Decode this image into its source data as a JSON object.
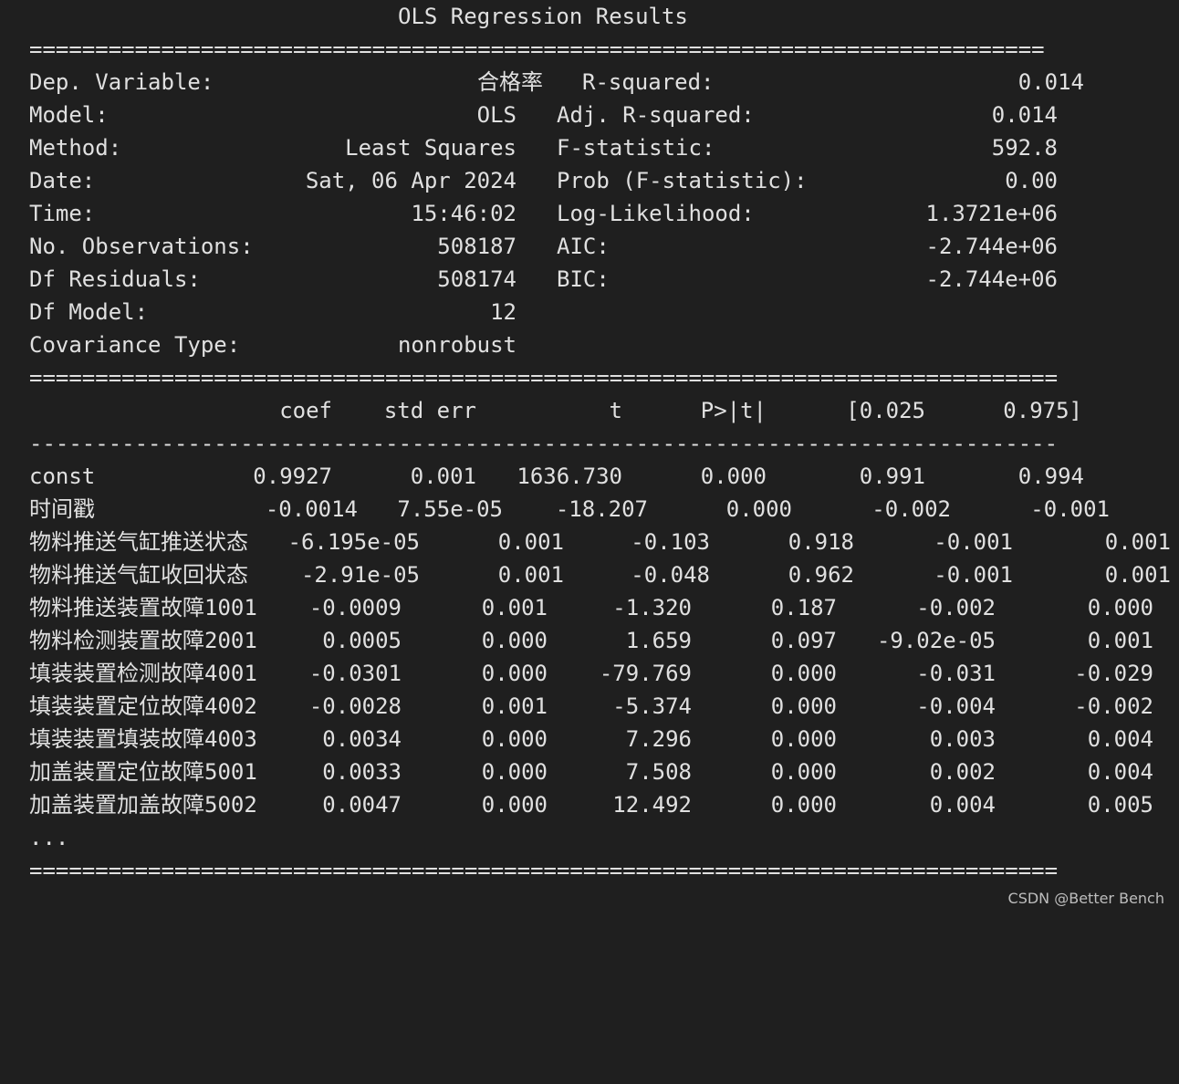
{
  "title": "OLS Regression Results",
  "separators": {
    "double_top": "=============================================================================",
    "double_mid": "==============================================================================",
    "single_mid": "------------------------------------------------------------------------------",
    "double_bottom": "=============================================================================="
  },
  "summary_left": [
    {
      "label": "Dep. Variable:",
      "value": "合格率"
    },
    {
      "label": "Model:",
      "value": "OLS"
    },
    {
      "label": "Method:",
      "value": "Least Squares"
    },
    {
      "label": "Date:",
      "value": "Sat, 06 Apr 2024"
    },
    {
      "label": "Time:",
      "value": "15:46:02"
    },
    {
      "label": "No. Observations:",
      "value": "508187"
    },
    {
      "label": "Df Residuals:",
      "value": "508174"
    },
    {
      "label": "Df Model:",
      "value": "12"
    },
    {
      "label": "Covariance Type:",
      "value": "nonrobust"
    }
  ],
  "summary_right": [
    {
      "label": "R-squared:",
      "value": "0.014"
    },
    {
      "label": "Adj. R-squared:",
      "value": "0.014"
    },
    {
      "label": "F-statistic:",
      "value": "592.8"
    },
    {
      "label": "Prob (F-statistic):",
      "value": "0.00"
    },
    {
      "label": "Log-Likelihood:",
      "value": "1.3721e+06"
    },
    {
      "label": "AIC:",
      "value": "-2.744e+06"
    },
    {
      "label": "BIC:",
      "value": "-2.744e+06"
    }
  ],
  "coef_headers": [
    "coef",
    "std err",
    "t",
    "P>|t|",
    "[0.025",
    "0.975]"
  ],
  "coef_rows": [
    {
      "name": "const",
      "values": [
        "0.9927",
        "0.001",
        "1636.730",
        "0.000",
        "0.991",
        "0.994"
      ]
    },
    {
      "name": "时间戳",
      "values": [
        "-0.0014",
        "7.55e-05",
        "-18.207",
        "0.000",
        "-0.002",
        "-0.001"
      ]
    },
    {
      "name": "物料推送气缸推送状态",
      "values": [
        "-6.195e-05",
        "0.001",
        "-0.103",
        "0.918",
        "-0.001",
        "0.001"
      ]
    },
    {
      "name": "物料推送气缸收回状态",
      "values": [
        "-2.91e-05",
        "0.001",
        "-0.048",
        "0.962",
        "-0.001",
        "0.001"
      ]
    },
    {
      "name": "物料推送装置故障1001",
      "values": [
        "-0.0009",
        "0.001",
        "-1.320",
        "0.187",
        "-0.002",
        "0.000"
      ]
    },
    {
      "name": "物料检测装置故障2001",
      "values": [
        "0.0005",
        "0.000",
        "1.659",
        "0.097",
        "-9.02e-05",
        "0.001"
      ]
    },
    {
      "name": "填装装置检测故障4001",
      "values": [
        "-0.0301",
        "0.000",
        "-79.769",
        "0.000",
        "-0.031",
        "-0.029"
      ]
    },
    {
      "name": "填装装置定位故障4002",
      "values": [
        "-0.0028",
        "0.001",
        "-5.374",
        "0.000",
        "-0.004",
        "-0.002"
      ]
    },
    {
      "name": "填装装置填装故障4003",
      "values": [
        "0.0034",
        "0.000",
        "7.296",
        "0.000",
        "0.003",
        "0.004"
      ]
    },
    {
      "name": "加盖装置定位故障5001",
      "values": [
        "0.0033",
        "0.000",
        "7.508",
        "0.000",
        "0.002",
        "0.004"
      ]
    },
    {
      "name": "加盖装置加盖故障5002",
      "values": [
        "0.0047",
        "0.000",
        "12.492",
        "0.000",
        "0.004",
        "0.005"
      ]
    }
  ],
  "ellipsis": "...",
  "watermark": "CSDN @Better Bench"
}
